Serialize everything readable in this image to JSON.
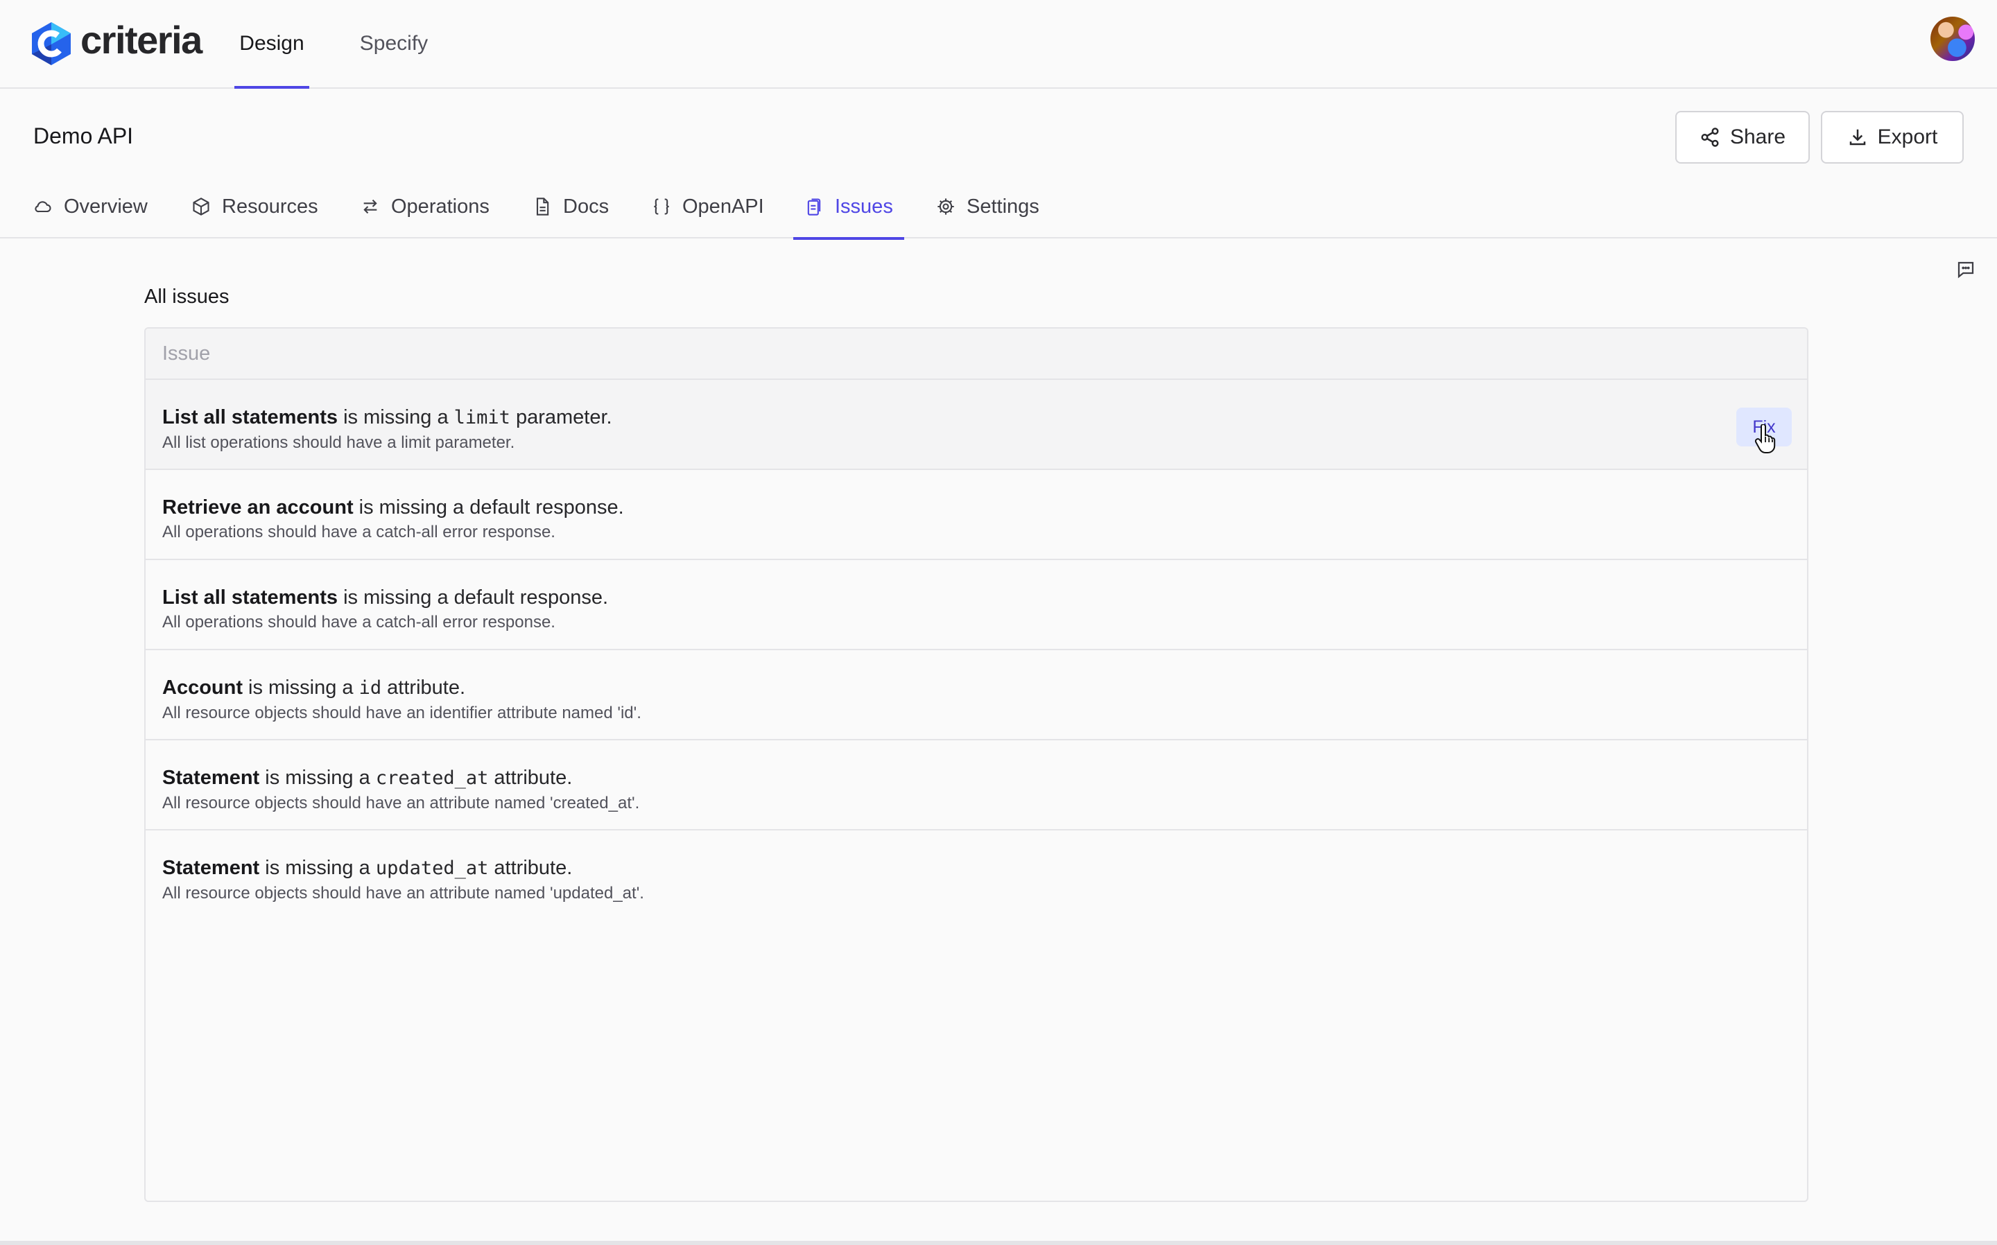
{
  "app": {
    "logo_text": "criteria",
    "brand_color": "#4f46e5",
    "logo_colors": [
      "#1d4ed8",
      "#38bdf8",
      "#6366f1"
    ]
  },
  "top_tabs": [
    {
      "label": "Design",
      "active": true
    },
    {
      "label": "Specify",
      "active": false
    }
  ],
  "project": {
    "title": "Demo API",
    "share_label": "Share",
    "export_label": "Export"
  },
  "sub_tabs": [
    {
      "label": "Overview",
      "icon": "cloud-icon"
    },
    {
      "label": "Resources",
      "icon": "cube-icon"
    },
    {
      "label": "Operations",
      "icon": "arrows-exchange-icon"
    },
    {
      "label": "Docs",
      "icon": "document-icon"
    },
    {
      "label": "OpenAPI",
      "icon": "braces-icon"
    },
    {
      "label": "Issues",
      "icon": "clipboard-icon",
      "active": true
    },
    {
      "label": "Settings",
      "icon": "gear-icon"
    }
  ],
  "issues": {
    "section_title": "All issues",
    "column_header": "Issue",
    "fix_label": "Fix",
    "rows": [
      {
        "subject": "List all statements",
        "pre": " is missing a ",
        "code": "limit",
        "post": " parameter.",
        "description": "All list operations should have a limit parameter."
      },
      {
        "subject": "Retrieve an account",
        "pre": " is missing a default response.",
        "code": "",
        "post": "",
        "description": "All operations should have a catch-all error response."
      },
      {
        "subject": "List all statements",
        "pre": " is missing a default response.",
        "code": "",
        "post": "",
        "description": "All operations should have a catch-all error response."
      },
      {
        "subject": "Account",
        "pre": " is missing a ",
        "code": "id",
        "post": " attribute.",
        "description": "All resource objects should have an identifier attribute named 'id'."
      },
      {
        "subject": "Statement",
        "pre": " is missing a ",
        "code": "created_at",
        "post": " attribute.",
        "description": "All resource objects should have an attribute named 'created_at'."
      },
      {
        "subject": "Statement",
        "pre": " is missing a ",
        "code": "updated_at",
        "post": " attribute.",
        "description": "All resource objects should have an attribute named 'updated_at'."
      }
    ]
  }
}
